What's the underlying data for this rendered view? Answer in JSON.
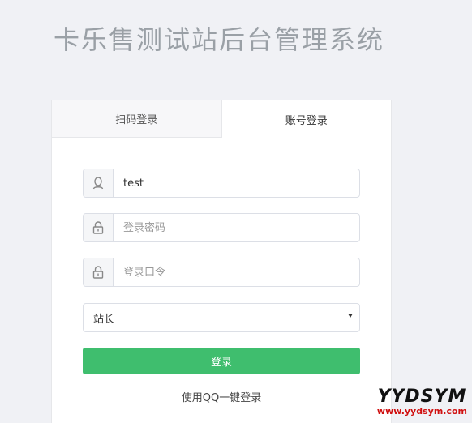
{
  "page": {
    "title": "卡乐售测试站后台管理系统"
  },
  "tabs": {
    "scan_login": "扫码登录",
    "account_login": "账号登录"
  },
  "form": {
    "username_value": "test",
    "password_placeholder": "登录密码",
    "token_placeholder": "登录口令",
    "role_selected": "站长",
    "submit_label": "登录",
    "qq_login_label": "使用QQ一键登录"
  },
  "watermark": {
    "logo": "YYDSYM",
    "url": "www.yydsym.com"
  },
  "colors": {
    "background": "#f0f1f5",
    "primary": "#3fbe6e",
    "title": "#9aa0a6",
    "watermark_url": "#d01010"
  },
  "icons": {
    "username": "user-icon",
    "password": "lock-icon",
    "token": "lock-icon",
    "select": "caret-down-icon"
  }
}
